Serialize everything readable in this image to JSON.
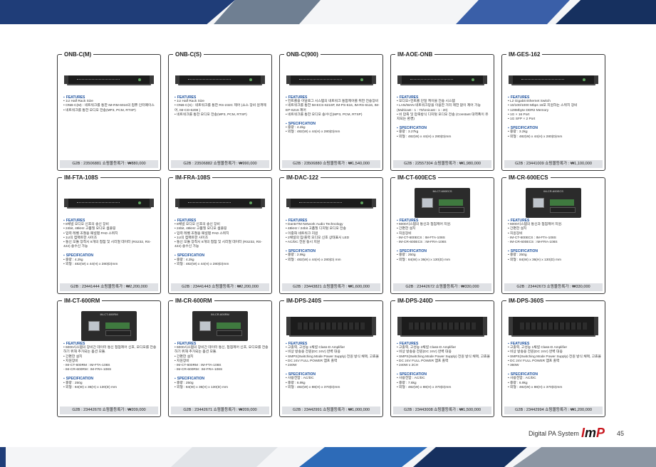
{
  "page": {
    "footer": "Digital PA System",
    "brand": "ImP",
    "brand_parts": [
      "I",
      "m",
      "P"
    ],
    "page_number": "45"
  },
  "products": [
    {
      "name": "ONB-C(M)",
      "device": "rack",
      "features": [
        "• 1U Half Rack Size",
        "• ONB-C(M) : 네트워크를 통한 IM-RM-6016의 컴퓨 인터페이스",
        "• 네트워크를 통한 오디오 전송(MP3, PCM, RTSP)"
      ],
      "specs": [],
      "price": "G2B : 23506881   쇼핑몰등록가 : ₩880,000"
    },
    {
      "name": "ONB-C(S)",
      "device": "rack",
      "features": [
        "• 1U Half Rack Size",
        "• ONB-C(S) : 네트워크를 통한 RS-232C 제어 (소스 장비 원격제어, IM-CD-6208 )",
        "• 네트워크를 통한 오디오 전송(MP3, PCM, RTSP)"
      ],
      "specs": [],
      "price": "G2B : 23506882   쇼핑몰등록가 : ₩990,000"
    },
    {
      "name": "ONB-C(900)",
      "device": "rack",
      "features": [
        "• 컨트롤용 아날로그 시스템의 네트워크 통합제어를 위한 전송장비",
        "• 네트워크를 통한 IM-ECS-6216P, IM-PS-616, IM-RS-6116, IM-EP-6216 제어",
        "• 네트워크를 통한 오디오 송/수신(MP3, PCM, RTSP)"
      ],
      "specs": [
        "• 중량 : 4.2kg",
        "• 외형 : 482(W) x 44(H) x 280(D)mm"
      ],
      "price": "G2B : 23506880   쇼핑몰등록가 : ₩1,540,000"
    },
    {
      "name": "IM-AOE-ONB",
      "device": "rack",
      "features": [
        "• 오디오+컨트롤 단일 케이블 전송 시스템",
        "• LAN/WAN 네트워크망을 이용한 거리 제한 없이 제어 가능 (Multicast : 1 : 70/Unicast : 1 : 20)",
        "• 비 압축 및 압축방식 디지털 오디오 전송 (Constant 대역폭이 유지되는 환경)"
      ],
      "specs": [
        "• 중량 : 3.27kg",
        "• 외형 : 482(W) x 44(H) x 280(D)mm"
      ],
      "price": "G2B : 22557304   쇼핑몰등록가 : ₩1,980,000"
    },
    {
      "name": "IM-GES-162",
      "device": "rack",
      "features": [
        "• L2 Gigabit Ethernet Switch",
        "• 10/100/1000 Mbps 16포 지원하는 스위치 장비",
        "• 128Mbyte DDR2 Memory",
        "• 1G × 16 Port",
        "• 1G SFP × 2 Port"
      ],
      "specs": [
        "• 중량 : 3.2kg",
        "• 외형 : 482(W) x 44(H) x 280(D)mm"
      ],
      "price": "G2B : 23441009   쇼핑몰등록가 : ₩1,100,000"
    },
    {
      "name": "IM-FTA-108S",
      "device": "rack",
      "features": [
        "• 8채널 오디오 신호의 송신 장비",
        "• 24bit, 48kHz 고품질 오디오 샘플링",
        "• 입력 레벨 조절용 패널별 PAD 스위치",
        "• 1U의 컴팩트한 사이즈",
        "• 통신 모듈 장착시 8개의 접점 및 시리얼 데이터 (RS232, RS-422) 송수신 가능"
      ],
      "specs": [
        "• 중량 : 4.2kg",
        "• 외형 : 482(W) x 44(H) x 280(D)mm"
      ],
      "price": "G2B : 23441444   쇼핑몰등록가 : ₩2,200,000"
    },
    {
      "name": "IM-FRA-108S",
      "device": "rack",
      "features": [
        "• 8채널 오디오 신호의 송신 장비",
        "• 24bit, 48kHz 고품질 오디오 샘플링",
        "• 입력 레벨 조절용 패널별 PAD 스위치",
        "• 1U의 컴팩트한 사이즈",
        "• 통신 모듈 장착시 8개의 접점 및 시리얼 데이터 (RS232, RS-422) 송수신 가능"
      ],
      "specs": [
        "• 중량 : 4.2kg",
        "• 외형 : 482(W) x 44(H) x 280(D)mm"
      ],
      "price": "G2B : 23441443   쇼핑몰등록가 : ₩2,200,000"
    },
    {
      "name": "IM-DAC-122",
      "device": "rack",
      "features": [
        "• DanteTM Network Audio Technology",
        "• 48kHz / 24bit 고품질 디지털 오디오 전송",
        "• 이중화 네트워크 지원",
        "• 2채널의 입/출력 오디오 신호 상태표시 LED",
        "• AC/DC 전원 동시 지원"
      ],
      "specs": [
        "• 중량 : 2.9kg",
        "• 외형 : 482(W) x 44(H) x 280(D) mm"
      ],
      "price": "G2B : 23443821   쇼핑몰등록가 : ₩1,600,000"
    },
    {
      "name": "IM-CT-600ECS",
      "device": "module",
      "module_label": "IM-CT-600ECS",
      "features": [
        "• 6000시스템의 통신과 접점제어 지원.",
        "• 간편한 설치",
        "• 지원장비",
        "  - IM-CT-600ECS : IM-FTA-108S",
        "  - IM-CR-600ECS : IM-FRA-108S"
      ],
      "specs": [
        "• 중량 : 250g",
        "• 외형 : 84(W) x 36(H) x 130(D) mm"
      ],
      "price": "G2B : 23442672   쇼핑몰등록가 : ₩330,000"
    },
    {
      "name": "IM-CR-600ECS",
      "device": "module",
      "module_label": "IM-CR-600ECS",
      "features": [
        "• 6000시스템의 통신과 접점제어 지원.",
        "• 간편한 설치",
        "• 지원장비",
        "  - IM-CT-600ECS : IM-FTA-108S",
        "  - IM-CR-600ECS : IM-FRA-108S"
      ],
      "specs": [
        "• 중량 : 250g",
        "• 외형 : 84(W) x 36(H) x 130(D) mm"
      ],
      "price": "G2B : 23442673   쇼핑몰등록가 : ₩330,000"
    },
    {
      "name": "IM-CT-600RM",
      "device": "module",
      "module_label": "IM-CT-600RM",
      "features": [
        "• 6000시스템의 장비간 데이터 통신 접점제어 신호, 오디오를 전송하기 위해 추가되는 옵션 모듈.",
        "• 간편한 설치",
        "• 지원장비",
        "  - IM-CT-600RM : IM-FTA-108S",
        "  - IM-CR-600RM : IM-FRA-108S"
      ],
      "specs": [
        "• 중량 : 250g",
        "• 외형 : 84(W) x 36(H) x 130(D) mm"
      ],
      "price": "G2B : 23442670   쇼핑몰등록가 : ₩209,000"
    },
    {
      "name": "IM-CR-600RM",
      "device": "module",
      "module_label": "IM-CR-600RM",
      "features": [
        "• 6000시스템의 장비간 데이터 통신, 접점제어 신호, 오디오를 전송하기 위해 추가되는 옵션 모듈.",
        "• 간편한 설치",
        "• 지원장비",
        "  - IM-CT-600RM : IM-FTA-108S",
        "  - IM-CR-600RM : IM-FRA-108S"
      ],
      "specs": [
        "• 중량 : 250g",
        "• 외형 : 84(W) x 36(H) x 130(D) mm"
      ],
      "price": "G2B : 23442671   쇼핑몰등록가 : ₩209,000"
    },
    {
      "name": "IM-DPS-240S",
      "device": "rack2",
      "features": [
        "• 고출력, 고성능 1채널 Class-D Amplifier",
        "• 비상 방송용 전원(DC 24V) 완벽 대응",
        "• SMPS(Switching Mode Power Supply) 전원 방식 채택, 고효율",
        "• DC 24V FULL POWER 앰프 출력",
        "• 240W"
      ],
      "specs": [
        "• 사용전압 : AC/DC",
        "• 중량 : 6.9kg",
        "• 외형 : 482(W) x 88(H) x 370(D)mm"
      ],
      "price": "G2B : 23442991   쇼핑몰등록가 : ₩1,000,000"
    },
    {
      "name": "IM-DPS-240D",
      "device": "rack2",
      "features": [
        "• 고출력, 고성능 2채널 Class-D Amplifier",
        "• 비상 방송용 전원(DC 24V) 완벽 대응",
        "• SMPS(Switching Mode Power Supply) 전원 방식 채택, 고효율",
        "• DC 24V FULL POWER 앰프 출력",
        "• 240W x 2CH"
      ],
      "specs": [
        "• 사용전압 : AC/DC",
        "• 중량 : 7.6kg",
        "• 외형 : 482(W) x 88(H) x 370(D)mm"
      ],
      "price": "G2B : 23443008   쇼핑몰등록가 : ₩1,500,000"
    },
    {
      "name": "IM-DPS-360S",
      "device": "rack2",
      "features": [
        "• 고출력, 고성능 1채널 Class-D Amplifier",
        "• 비상 방송용 전원(DC 24V) 완벽 대응",
        "• SMPS(Switching Mode Power Supply) 전원 방식 채택, 고효율",
        "• DC 24V FULL POWER 앰프 출력",
        "• 360W"
      ],
      "specs": [
        "• 사용전압 : AC/DC",
        "• 중량 : 6.9kg",
        "• 외형 : 482(W) x 88(H) x 370(D)mm"
      ],
      "price": "G2B : 23442994   쇼핑몰등록가 : ₩1,200,000"
    }
  ],
  "labels": {
    "features": "FEATURES",
    "specification": "SPECIFICATION"
  }
}
